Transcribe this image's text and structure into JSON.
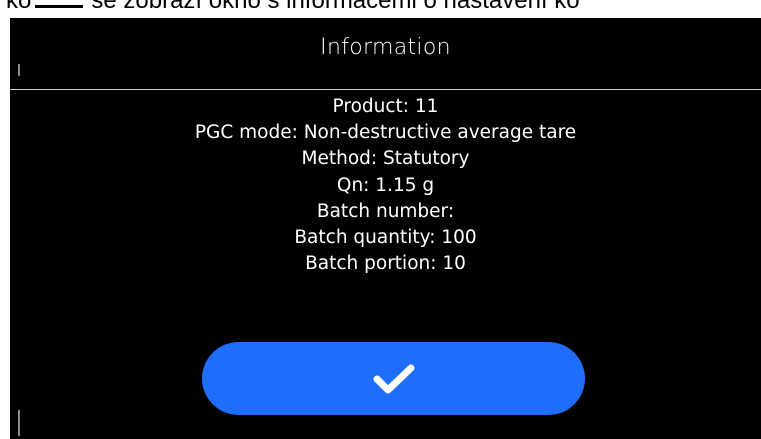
{
  "document_caption": {
    "before_icon": "ko",
    "after_icon": "se zobrazí okno s informacemi o nastavení ko"
  },
  "dialog": {
    "title": "Information",
    "lines": [
      "Product: 11",
      "PGC mode: Non-destructive average tare",
      "Method: Statutory",
      "Qn: 1.15 g",
      "Batch number:",
      "Batch quantity: 100",
      "Batch portion: 10"
    ],
    "confirm_button": {
      "icon": "checkmark-icon"
    }
  },
  "colors": {
    "screen_background": "#000000",
    "text": "#ffffff",
    "divider": "#cfcfcf",
    "button": "#1e6dfb"
  }
}
